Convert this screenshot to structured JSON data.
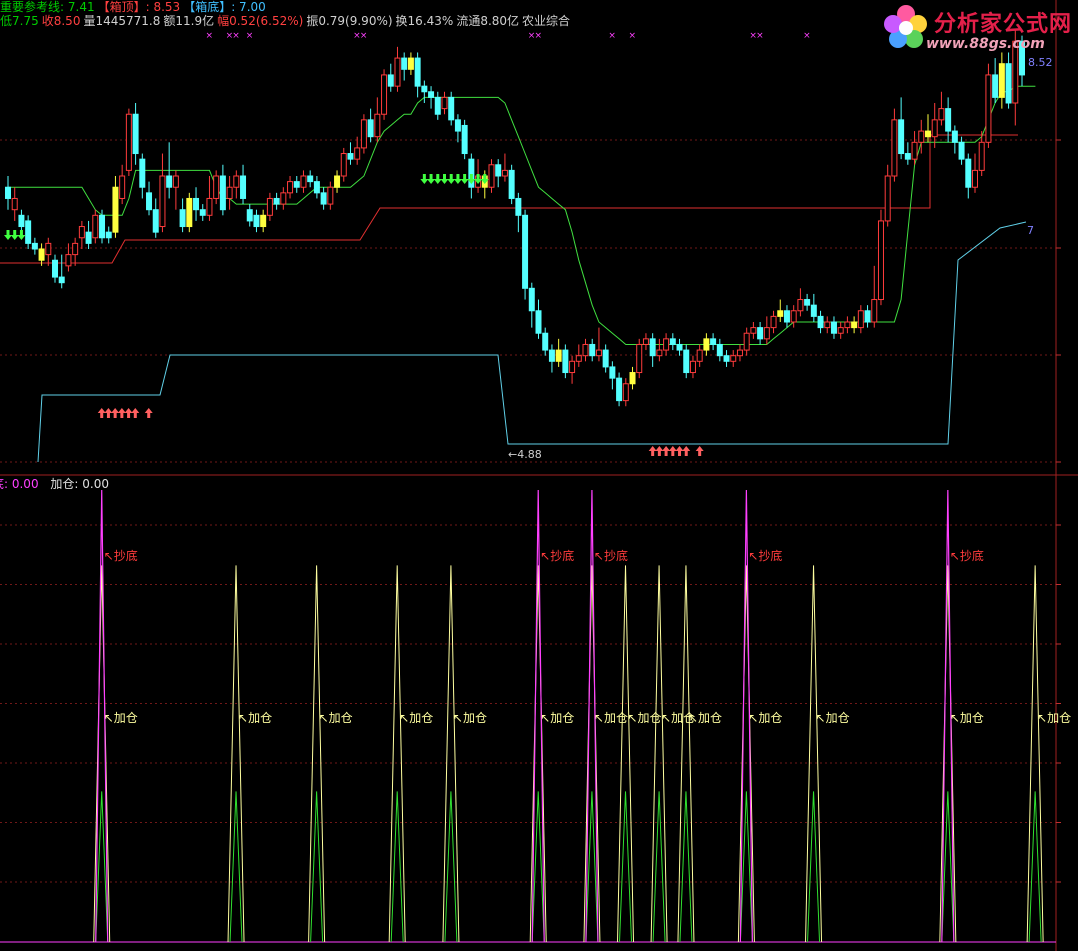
{
  "header": {
    "line1": [
      {
        "text": "重要参考线",
        "color": "#00cc00"
      },
      {
        "text": ": 7.41",
        "color": "#00cc00"
      },
      {
        "text": "【箱顶】",
        "color": "#ff4040"
      },
      {
        "text": ": 8.53",
        "color": "#ff4040"
      },
      {
        "text": "【箱底】",
        "color": "#40c0ff"
      },
      {
        "text": ": 7.00",
        "color": "#40c0ff"
      }
    ],
    "line2": [
      {
        "text": "低7.75",
        "color": "#00cc00"
      },
      {
        "text": "收8.50",
        "color": "#ff4040"
      },
      {
        "text": "量1445771.8",
        "color": "#d0d0d0"
      },
      {
        "text": "额11.9亿",
        "color": "#d0d0d0"
      },
      {
        "text": "幅0.52(6.52%)",
        "color": "#ff4040"
      },
      {
        "text": "振0.79(9.90%)",
        "color": "#d0d0d0"
      },
      {
        "text": "换16.43%",
        "color": "#d0d0d0"
      },
      {
        "text": "流通8.80亿",
        "color": "#d0d0d0"
      },
      {
        "text": "农业综合",
        "color": "#d0d0d0"
      }
    ]
  },
  "indicator_header": {
    "cut_label": "底: 0.00",
    "add_label": "加仓: 0.00"
  },
  "logo": {
    "name": "分析家公式网",
    "url": "www.88gs.com"
  },
  "colors": {
    "up": "#ff3c3c",
    "down": "#54ffff",
    "flat": "#ffff40",
    "box_top": "#e03030",
    "box_bottom": "#60d0e8",
    "ref": "#40e040",
    "chaodi": "#ff40ff",
    "jiacang": "#ffffa0",
    "chaodi_green": "#30e030"
  },
  "chart_data": [
    {
      "type": "candlestick",
      "price_range": [
        4.7,
        8.6
      ],
      "candles": [
        [
          7.2,
          7.1,
          7.3,
          7.0
        ],
        [
          7.0,
          7.1,
          7.2,
          6.9
        ],
        [
          6.95,
          6.85,
          7.0,
          6.8
        ],
        [
          6.9,
          6.7,
          6.95,
          6.65
        ],
        [
          6.7,
          6.65,
          6.75,
          6.6
        ],
        [
          6.65,
          6.55,
          6.7,
          6.5
        ],
        [
          6.6,
          6.7,
          6.75,
          6.5
        ],
        [
          6.55,
          6.4,
          6.6,
          6.35
        ],
        [
          6.4,
          6.35,
          6.6,
          6.3
        ],
        [
          6.5,
          6.6,
          6.7,
          6.45
        ],
        [
          6.6,
          6.7,
          6.75,
          6.5
        ],
        [
          6.75,
          6.85,
          6.9,
          6.65
        ],
        [
          6.8,
          6.7,
          6.9,
          6.65
        ],
        [
          6.75,
          6.95,
          7.0,
          6.7
        ],
        [
          6.95,
          6.75,
          7.0,
          6.7
        ],
        [
          6.8,
          6.75,
          6.85,
          6.7
        ],
        [
          6.8,
          7.2,
          7.3,
          6.75
        ],
        [
          7.1,
          7.3,
          7.4,
          7.05
        ],
        [
          7.35,
          7.85,
          7.9,
          7.3
        ],
        [
          7.85,
          7.5,
          7.95,
          7.4
        ],
        [
          7.45,
          7.2,
          7.5,
          7.1
        ],
        [
          7.15,
          7.0,
          7.25,
          6.95
        ],
        [
          7.0,
          6.8,
          7.1,
          6.75
        ],
        [
          6.85,
          7.3,
          7.5,
          6.8
        ],
        [
          7.3,
          7.2,
          7.6,
          7.1
        ],
        [
          7.2,
          7.3,
          7.35,
          7.0
        ],
        [
          7.0,
          6.85,
          7.1,
          6.8
        ],
        [
          6.85,
          7.1,
          7.15,
          6.8
        ],
        [
          7.1,
          7.0,
          7.2,
          6.9
        ],
        [
          7.0,
          6.95,
          7.05,
          6.9
        ],
        [
          6.95,
          7.1,
          7.3,
          6.9
        ],
        [
          7.1,
          7.3,
          7.35,
          7.05
        ],
        [
          7.3,
          7.0,
          7.4,
          6.95
        ],
        [
          7.1,
          7.2,
          7.3,
          7.0
        ],
        [
          7.2,
          7.3,
          7.35,
          7.1
        ],
        [
          7.3,
          7.1,
          7.4,
          7.05
        ],
        [
          7.0,
          6.9,
          7.05,
          6.85
        ],
        [
          6.95,
          6.85,
          7.0,
          6.8
        ],
        [
          6.85,
          6.95,
          7.0,
          6.8
        ],
        [
          6.95,
          7.1,
          7.15,
          6.9
        ],
        [
          7.1,
          7.05,
          7.15,
          7.0
        ],
        [
          7.05,
          7.15,
          7.2,
          7.0
        ],
        [
          7.15,
          7.25,
          7.3,
          7.1
        ],
        [
          7.25,
          7.2,
          7.3,
          7.15
        ],
        [
          7.2,
          7.3,
          7.35,
          7.15
        ],
        [
          7.3,
          7.25,
          7.35,
          7.2
        ],
        [
          7.25,
          7.15,
          7.3,
          7.1
        ],
        [
          7.15,
          7.05,
          7.2,
          7.0
        ],
        [
          7.05,
          7.2,
          7.25,
          7.0
        ],
        [
          7.2,
          7.3,
          7.35,
          7.15
        ],
        [
          7.3,
          7.5,
          7.55,
          7.25
        ],
        [
          7.5,
          7.45,
          7.6,
          7.4
        ],
        [
          7.45,
          7.55,
          7.65,
          7.4
        ],
        [
          7.55,
          7.8,
          7.85,
          7.5
        ],
        [
          7.8,
          7.65,
          7.9,
          7.6
        ],
        [
          7.65,
          7.85,
          8.0,
          7.6
        ],
        [
          7.85,
          8.2,
          8.25,
          7.8
        ],
        [
          8.2,
          8.1,
          8.3,
          8.05
        ],
        [
          8.1,
          8.35,
          8.45,
          8.05
        ],
        [
          8.35,
          8.25,
          8.4,
          8.15
        ],
        [
          8.25,
          8.35,
          8.4,
          8.2
        ],
        [
          8.35,
          8.1,
          8.4,
          8.0
        ],
        [
          8.1,
          8.05,
          8.15,
          7.95
        ],
        [
          8.05,
          8.0,
          8.1,
          7.9
        ],
        [
          8.0,
          7.85,
          8.05,
          7.8
        ],
        [
          7.9,
          8.0,
          8.05,
          7.85
        ],
        [
          8.0,
          7.8,
          8.05,
          7.75
        ],
        [
          7.8,
          7.7,
          7.85,
          7.6
        ],
        [
          7.75,
          7.5,
          7.8,
          7.45
        ],
        [
          7.45,
          7.2,
          7.5,
          7.1
        ],
        [
          7.2,
          7.3,
          7.45,
          7.15
        ],
        [
          7.3,
          7.2,
          7.35,
          7.1
        ],
        [
          7.2,
          7.4,
          7.45,
          7.15
        ],
        [
          7.4,
          7.3,
          7.45,
          7.2
        ],
        [
          7.3,
          7.35,
          7.5,
          7.25
        ],
        [
          7.35,
          7.1,
          7.4,
          7.05
        ],
        [
          7.1,
          6.95,
          7.15,
          6.8
        ],
        [
          6.95,
          6.3,
          7.0,
          6.2
        ],
        [
          6.3,
          6.1,
          6.35,
          5.95
        ],
        [
          6.1,
          5.9,
          6.2,
          5.85
        ],
        [
          5.9,
          5.75,
          5.95,
          5.7
        ],
        [
          5.75,
          5.65,
          5.8,
          5.55
        ],
        [
          5.65,
          5.75,
          5.85,
          5.6
        ],
        [
          5.75,
          5.55,
          5.8,
          5.5
        ],
        [
          5.55,
          5.65,
          5.7,
          5.45
        ],
        [
          5.65,
          5.7,
          5.8,
          5.6
        ],
        [
          5.7,
          5.8,
          5.85,
          5.65
        ],
        [
          5.8,
          5.7,
          5.85,
          5.65
        ],
        [
          5.7,
          5.75,
          5.95,
          5.65
        ],
        [
          5.75,
          5.6,
          5.8,
          5.55
        ],
        [
          5.6,
          5.5,
          5.65,
          5.4
        ],
        [
          5.5,
          5.3,
          5.55,
          5.25
        ],
        [
          5.3,
          5.45,
          5.5,
          5.25
        ],
        [
          5.45,
          5.55,
          5.6,
          5.4
        ],
        [
          5.55,
          5.8,
          5.85,
          5.5
        ],
        [
          5.8,
          5.85,
          5.9,
          5.75
        ],
        [
          5.85,
          5.7,
          5.9,
          5.6
        ],
        [
          5.7,
          5.75,
          5.85,
          5.65
        ],
        [
          5.75,
          5.85,
          5.9,
          5.7
        ],
        [
          5.85,
          5.8,
          5.9,
          5.75
        ],
        [
          5.8,
          5.75,
          5.85,
          5.7
        ],
        [
          5.75,
          5.55,
          5.8,
          5.5
        ],
        [
          5.55,
          5.65,
          5.7,
          5.5
        ],
        [
          5.65,
          5.75,
          5.8,
          5.6
        ],
        [
          5.75,
          5.85,
          5.9,
          5.7
        ],
        [
          5.85,
          5.8,
          5.9,
          5.75
        ],
        [
          5.8,
          5.7,
          5.85,
          5.65
        ],
        [
          5.7,
          5.65,
          5.75,
          5.6
        ],
        [
          5.65,
          5.7,
          5.75,
          5.6
        ],
        [
          5.7,
          5.75,
          5.8,
          5.65
        ],
        [
          5.75,
          5.9,
          5.95,
          5.7
        ],
        [
          5.9,
          5.95,
          6.0,
          5.85
        ],
        [
          5.95,
          5.85,
          6.0,
          5.8
        ],
        [
          5.85,
          5.95,
          6.05,
          5.8
        ],
        [
          5.95,
          6.05,
          6.1,
          5.9
        ],
        [
          6.05,
          6.1,
          6.2,
          6.0
        ],
        [
          6.1,
          6.0,
          6.15,
          5.95
        ],
        [
          6.0,
          6.1,
          6.15,
          5.95
        ],
        [
          6.1,
          6.2,
          6.3,
          6.05
        ],
        [
          6.2,
          6.15,
          6.25,
          6.1
        ],
        [
          6.15,
          6.05,
          6.25,
          6.0
        ],
        [
          6.05,
          5.95,
          6.1,
          5.9
        ],
        [
          5.95,
          6.0,
          6.05,
          5.9
        ],
        [
          6.0,
          5.9,
          6.05,
          5.85
        ],
        [
          5.9,
          5.95,
          6.0,
          5.85
        ],
        [
          5.95,
          6.0,
          6.05,
          5.9
        ],
        [
          6.0,
          5.95,
          6.05,
          5.9
        ],
        [
          5.95,
          6.1,
          6.15,
          5.9
        ],
        [
          6.1,
          6.0,
          6.15,
          5.95
        ],
        [
          6.0,
          6.2,
          6.5,
          5.95
        ],
        [
          6.2,
          6.9,
          7.0,
          6.15
        ],
        [
          6.9,
          7.3,
          7.4,
          6.85
        ],
        [
          7.3,
          7.8,
          7.9,
          7.25
        ],
        [
          7.8,
          7.5,
          8.0,
          7.45
        ],
        [
          7.5,
          7.45,
          7.6,
          7.4
        ],
        [
          7.45,
          7.6,
          7.7,
          7.4
        ],
        [
          7.6,
          7.7,
          7.8,
          7.5
        ],
        [
          7.7,
          7.65,
          7.85,
          7.6
        ],
        [
          7.65,
          7.8,
          7.95,
          7.55
        ],
        [
          7.8,
          7.9,
          8.05,
          7.75
        ],
        [
          7.9,
          7.7,
          8.0,
          7.6
        ],
        [
          7.7,
          7.6,
          7.75,
          7.5
        ],
        [
          7.6,
          7.45,
          7.65,
          7.4
        ],
        [
          7.45,
          7.2,
          7.5,
          7.1
        ],
        [
          7.2,
          7.35,
          7.5,
          7.15
        ],
        [
          7.35,
          7.6,
          7.7,
          7.3
        ],
        [
          7.6,
          8.2,
          8.3,
          7.55
        ],
        [
          8.2,
          8.0,
          8.35,
          7.95
        ],
        [
          8.0,
          8.3,
          8.4,
          7.9
        ],
        [
          8.3,
          7.95,
          8.4,
          7.9
        ],
        [
          7.95,
          8.5,
          8.6,
          7.75
        ],
        [
          8.5,
          8.2,
          8.55,
          8.1
        ]
      ],
      "reference_line_points": [
        7.2,
        7.2,
        7.2,
        7.2,
        7.2,
        7.2,
        7.2,
        7.2,
        7.2,
        7.2,
        7.2,
        7.2,
        7.1,
        7.0,
        6.95,
        6.95,
        6.95,
        6.95,
        7.1,
        7.35,
        7.35,
        7.35,
        7.35,
        7.35,
        7.35,
        7.35,
        7.35,
        7.35,
        7.35,
        7.35,
        7.35,
        7.2,
        7.1,
        7.1,
        7.05,
        7.05,
        7.05,
        7.05,
        7.05,
        7.05,
        7.05,
        7.05,
        7.05,
        7.05,
        7.1,
        7.15,
        7.2,
        7.2,
        7.2,
        7.2,
        7.2,
        7.2,
        7.25,
        7.3,
        7.45,
        7.6,
        7.7,
        7.75,
        7.8,
        7.85,
        7.85,
        7.95,
        8.0,
        8.0,
        8.0,
        8.0,
        8.0,
        8.0,
        8.0,
        8.0,
        8.0,
        8.0,
        8.0,
        8.0,
        7.95,
        7.8,
        7.65,
        7.5,
        7.35,
        7.2,
        7.15,
        7.1,
        7.05,
        7.0,
        6.8,
        6.55,
        6.35,
        6.15,
        6.0,
        5.95,
        5.9,
        5.85,
        5.8,
        5.8,
        5.8,
        5.8,
        5.8,
        5.8,
        5.8,
        5.8,
        5.8,
        5.8,
        5.8,
        5.8,
        5.8,
        5.8,
        5.8,
        5.8,
        5.8,
        5.8,
        5.8,
        5.8,
        5.8,
        5.8,
        5.85,
        5.9,
        5.95,
        6.0,
        6.0,
        6.0,
        6.0,
        6.0,
        6.0,
        6.0,
        6.0,
        6.0,
        6.0,
        6.0,
        6.0,
        6.0,
        6.0,
        6.0,
        6.0,
        6.2,
        6.8,
        7.4,
        7.6,
        7.6,
        7.6,
        7.6,
        7.6,
        7.6,
        7.6,
        7.6,
        7.6,
        7.65,
        7.8,
        7.95,
        8.05,
        8.05,
        8.1,
        8.1,
        8.1,
        8.1
      ],
      "box_top_value": 8.53,
      "box_bottom_value": 7.0,
      "axis_marks": {
        "high": "8.52",
        "low": "4.88",
        "bottom": "7"
      },
      "up_arrows_groups": [
        [
          8,
          9,
          10,
          11,
          12,
          13,
          15
        ],
        [
          96,
          97,
          98,
          99,
          100,
          101,
          103
        ]
      ],
      "down_arrows_groups": [
        [
          0,
          1,
          2
        ],
        [
          62,
          63,
          64,
          65,
          66,
          67,
          68,
          69,
          70,
          71
        ]
      ],
      "purple_x_marks": [
        16,
        19,
        20,
        22,
        38,
        39,
        64,
        65,
        76,
        79,
        97,
        98,
        105
      ]
    },
    {
      "type": "line",
      "title": "indicator",
      "ylim": [
        0,
        1.2
      ],
      "chaodi_label": "抄底",
      "jiacang_label": "加仓",
      "chaodi_at": [
        8,
        73,
        81,
        104,
        134
      ],
      "jiacang_at": [
        8,
        28,
        40,
        52,
        60,
        73,
        81,
        86,
        91,
        95,
        104,
        114,
        134,
        147,
        157,
        163
      ]
    }
  ]
}
